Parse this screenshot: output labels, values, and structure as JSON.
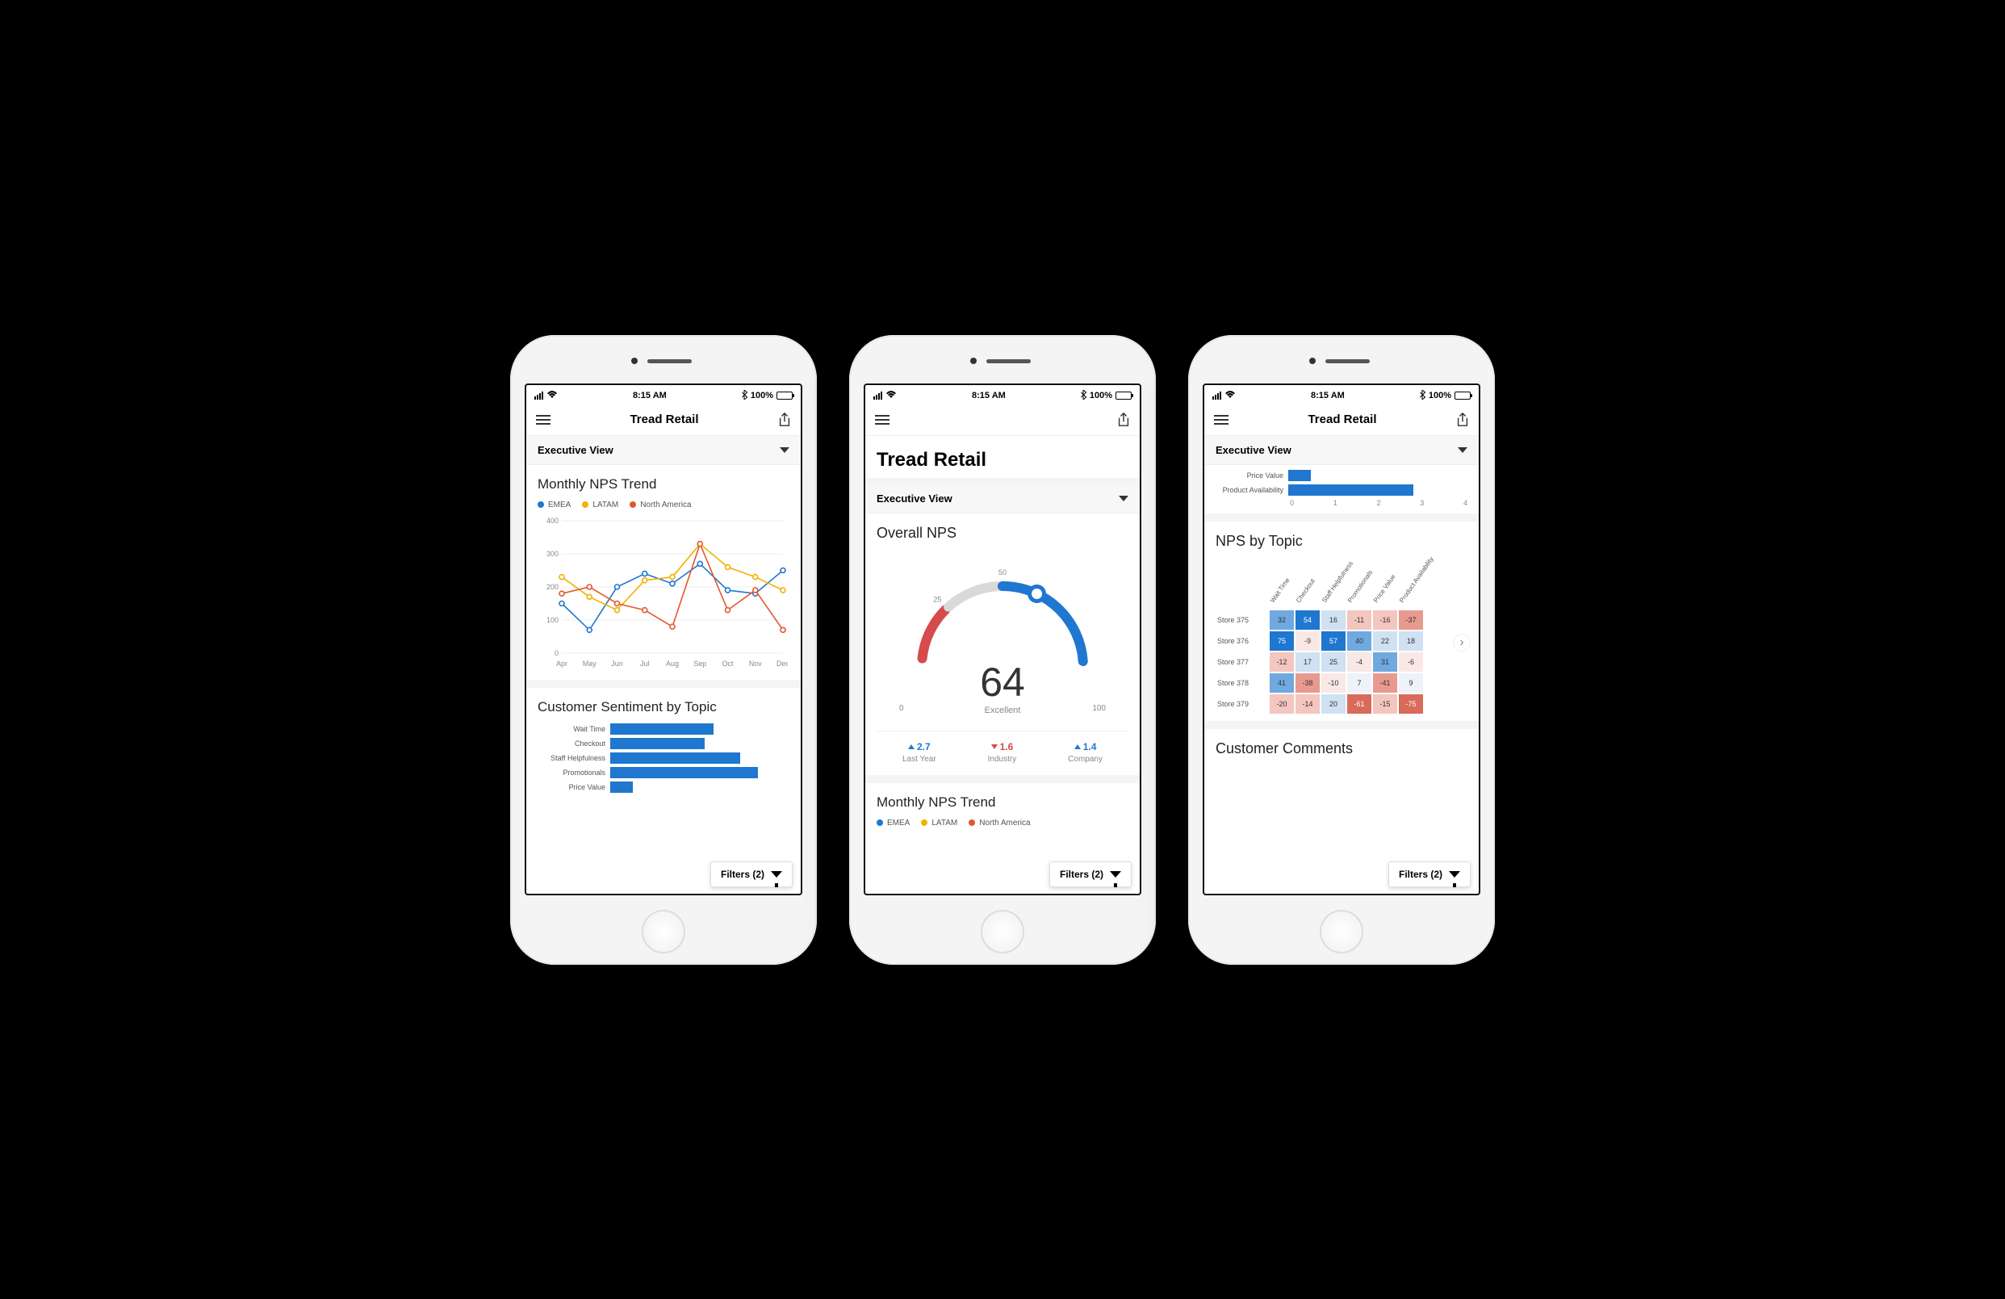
{
  "status_bar": {
    "time": "8:15 AM",
    "battery_text": "100%",
    "bluetooth": true
  },
  "app": {
    "title": "Tread Retail",
    "section": "Executive View"
  },
  "filters": {
    "label": "Filters (2)"
  },
  "phone1": {
    "chart1_title": "Monthly NPS Trend",
    "chart2_title": "Customer Sentiment by Topic"
  },
  "phone2": {
    "big_title": "Tread Retail",
    "gauge_title": "Overall NPS",
    "gauge_value": "64",
    "gauge_rating": "Excellent",
    "gauge_min": "0",
    "gauge_mid1": "25",
    "gauge_mid2": "50",
    "gauge_max": "100",
    "deltas": {
      "last_year": {
        "value": "2.7",
        "label": "Last Year",
        "dir": "up",
        "color": "blue"
      },
      "industry": {
        "value": "1.6",
        "label": "Industry",
        "dir": "down",
        "color": "red"
      },
      "company": {
        "value": "1.4",
        "label": "Company",
        "dir": "up",
        "color": "blue"
      }
    },
    "next_title": "Monthly NPS Trend"
  },
  "phone3": {
    "mini_bars_title_top": "Price Value",
    "mini_bars_title_bot": "Product Availability",
    "heat_title": "NPS by Topic",
    "comments_title": "Customer Comments"
  },
  "chart_data": [
    {
      "id": "monthly_nps_trend",
      "type": "line",
      "title": "Monthly NPS Trend",
      "xlabel": "",
      "ylabel": "",
      "ylim": [
        0,
        400
      ],
      "categories": [
        "Apr",
        "May",
        "Jun",
        "Jul",
        "Aug",
        "Sep",
        "Oct",
        "Nov",
        "Dec"
      ],
      "series": [
        {
          "name": "EMEA",
          "color": "#1f77d0",
          "values": [
            150,
            70,
            200,
            240,
            210,
            270,
            190,
            180,
            250
          ]
        },
        {
          "name": "LATAM",
          "color": "#f2b200",
          "values": [
            230,
            170,
            130,
            220,
            230,
            330,
            260,
            230,
            190
          ]
        },
        {
          "name": "North America",
          "color": "#e4572e",
          "values": [
            180,
            200,
            150,
            130,
            80,
            330,
            130,
            190,
            70
          ]
        }
      ]
    },
    {
      "id": "customer_sentiment_by_topic",
      "type": "bar",
      "orientation": "horizontal",
      "title": "Customer Sentiment by Topic",
      "xlim": [
        0,
        4
      ],
      "categories": [
        "Wait Time",
        "Checkout",
        "Staff Helpfulness",
        "Promotionals",
        "Price Value",
        "Product Availability"
      ],
      "values": [
        2.3,
        2.1,
        2.9,
        3.3,
        0.5,
        2.8
      ],
      "color": "#1f77d0"
    },
    {
      "id": "overall_nps_gauge",
      "type": "gauge",
      "title": "Overall NPS",
      "value": 64,
      "min": 0,
      "max": 100,
      "thresholds": [
        25,
        50
      ],
      "rating": "Excellent",
      "deltas": [
        {
          "label": "Last Year",
          "value": 2.7,
          "direction": "up"
        },
        {
          "label": "Industry",
          "value": 1.6,
          "direction": "down"
        },
        {
          "label": "Company",
          "value": 1.4,
          "direction": "up"
        }
      ]
    },
    {
      "id": "phone3_mini_bars",
      "type": "bar",
      "orientation": "horizontal",
      "xlim": [
        0,
        4
      ],
      "x_ticks": [
        0,
        1,
        2,
        3,
        4
      ],
      "categories": [
        "Price Value",
        "Product Availability"
      ],
      "values": [
        0.5,
        2.8
      ],
      "color": "#1f77d0"
    },
    {
      "id": "nps_by_topic_heatmap",
      "type": "heatmap",
      "title": "NPS by Topic",
      "columns": [
        "Wait Time",
        "Checkout",
        "Staff Helpfulness",
        "Promotionals",
        "Price Value",
        "Product Availability"
      ],
      "rows": [
        "Store 375",
        "Store 376",
        "Store 377",
        "Store 378",
        "Store 379"
      ],
      "values": [
        [
          32,
          54,
          16,
          -11,
          -16,
          -37
        ],
        [
          75,
          -9,
          57,
          40,
          22,
          18
        ],
        [
          -12,
          17,
          25,
          -4,
          31,
          -6
        ],
        [
          41,
          -38,
          -10,
          7,
          -41,
          9
        ],
        [
          -20,
          -14,
          20,
          -61,
          -15,
          -75
        ]
      ]
    }
  ]
}
